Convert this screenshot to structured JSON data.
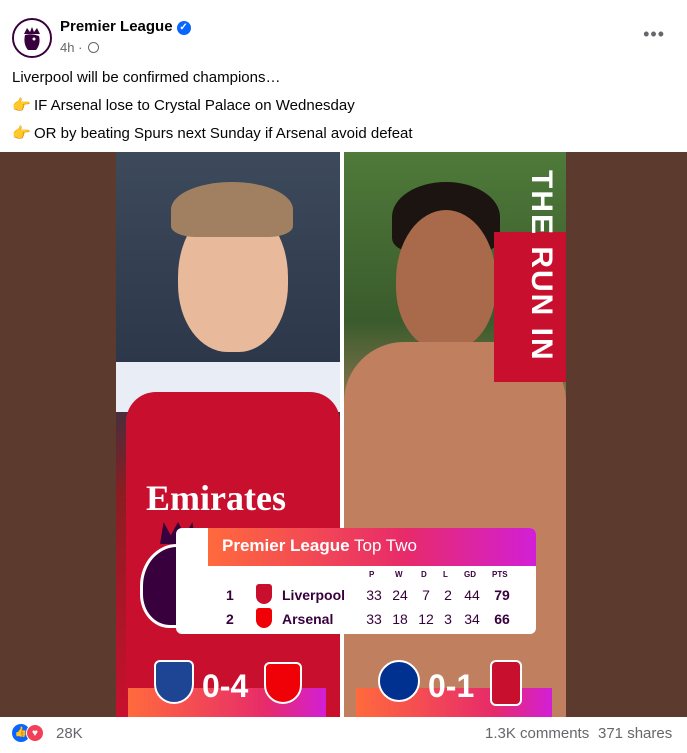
{
  "post": {
    "page_name": "Premier League",
    "time": "4h",
    "more_icon": "more-options-icon",
    "message": {
      "line1": "Liverpool will be confirmed champions…",
      "line2": "IF Arsenal lose to Crystal Palace on Wednesday",
      "line3": "OR by beating Spurs next Sunday if Arsenal avoid defeat",
      "bullet": "👉"
    }
  },
  "graphic": {
    "sponsor": "Emirates",
    "side_title": "THE RUN IN",
    "table": {
      "title_brand": "Premier League",
      "title_rest": "Top Two",
      "columns": [
        "P",
        "W",
        "D",
        "L",
        "GD",
        "PTS"
      ],
      "rows": [
        {
          "pos": "1",
          "team": "Liverpool",
          "P": "33",
          "W": "24",
          "D": "7",
          "L": "2",
          "GD": "44",
          "PTS": "79",
          "color": "#c8102e"
        },
        {
          "pos": "2",
          "team": "Arsenal",
          "P": "33",
          "W": "18",
          "D": "12",
          "L": "3",
          "GD": "34",
          "PTS": "66",
          "color": "#ef0107"
        }
      ]
    },
    "scores": [
      {
        "score": "0-4",
        "home_color": "#1e4494",
        "away_color": "#ef0107"
      },
      {
        "score": "0-1",
        "home_color": "#003090",
        "away_color": "#c8102e"
      }
    ],
    "brand_colors": {
      "purple": "#38003c",
      "pink": "#e72b6a",
      "orange": "#ff6a3d"
    }
  },
  "footer": {
    "reactions": "28K",
    "comments": "1.3K comments",
    "shares": "371 shares"
  }
}
